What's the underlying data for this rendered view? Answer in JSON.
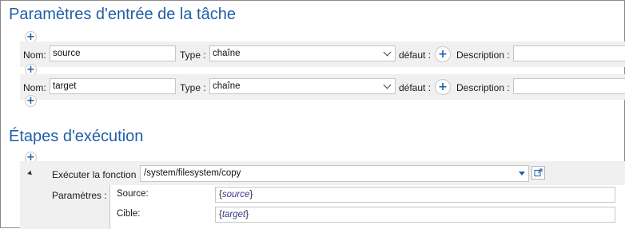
{
  "task_params": {
    "title": "Paramètres d'entrée de la tâche",
    "rows": [
      {
        "name_label": "Nom:",
        "name_value": "source",
        "type_label": "Type :",
        "type_value": "chaîne",
        "default_label": "défaut :",
        "description_label": "Description :",
        "description_value": ""
      },
      {
        "name_label": "Nom:",
        "name_value": "target",
        "type_label": "Type :",
        "type_value": "chaîne",
        "default_label": "défaut :",
        "description_label": "Description :",
        "description_value": ""
      }
    ]
  },
  "exec_steps": {
    "title": "Étapes d'exécution",
    "step": {
      "label": "Exécuter la fonction",
      "function": "/system/filesystem/copy",
      "params_label": "Paramètres :",
      "params": [
        {
          "label": "Source:",
          "open": "{",
          "var": "source",
          "close": "}"
        },
        {
          "label": "Cible:",
          "open": "{",
          "var": "target",
          "close": "}"
        }
      ]
    }
  },
  "icons": {
    "add": "plus-icon",
    "dropdown": "chevron-down-icon",
    "open_function": "external-link-icon",
    "collapse": "collapse-triangle-icon"
  },
  "colors": {
    "accent": "#1f5fa8",
    "row_bg": "#f0f0f0",
    "border": "#c6c6c6"
  }
}
